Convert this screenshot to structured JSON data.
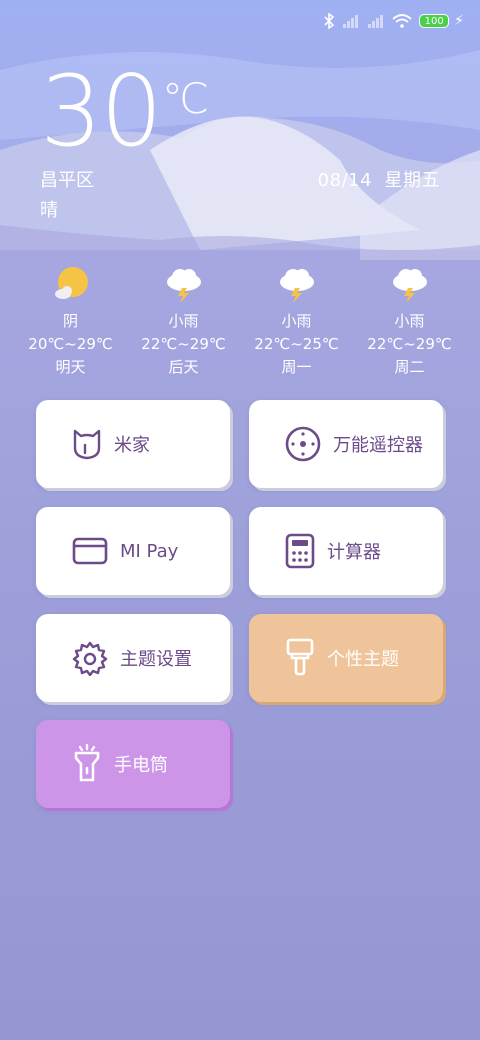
{
  "status_bar": {
    "icons": [
      "bluetooth-icon",
      "signal-icon",
      "signal-icon",
      "wifi-icon"
    ],
    "battery": "100",
    "charging_icon": "bolt-icon"
  },
  "current": {
    "temperature": "30",
    "unit": "℃",
    "location": "昌平区",
    "condition": "晴",
    "date": "08/14",
    "weekday": "星期五"
  },
  "forecast": [
    {
      "icon": "sun-cloud-icon",
      "condition": "阴",
      "range": "20℃~29℃",
      "day": "明天"
    },
    {
      "icon": "thunder-cloud-icon",
      "condition": "小雨",
      "range": "22℃~29℃",
      "day": "后天"
    },
    {
      "icon": "thunder-cloud-icon",
      "condition": "小雨",
      "range": "22℃~25℃",
      "day": "周一"
    },
    {
      "icon": "thunder-cloud-icon",
      "condition": "小雨",
      "range": "22℃~29℃",
      "day": "周二"
    }
  ],
  "tiles": [
    {
      "label": "米家",
      "icon": "mijia-icon",
      "style": "white"
    },
    {
      "label": "万能遥控器",
      "icon": "remote-icon",
      "style": "white"
    },
    {
      "label": "MI Pay",
      "icon": "card-icon",
      "style": "white"
    },
    {
      "label": "计算器",
      "icon": "calculator-icon",
      "style": "white"
    },
    {
      "label": "主题设置",
      "icon": "gear-icon",
      "style": "white"
    },
    {
      "label": "个性主题",
      "icon": "brush-icon",
      "style": "orange"
    },
    {
      "label": "手电筒",
      "icon": "flashlight-icon",
      "style": "purple"
    }
  ],
  "colors": {
    "accent_purple_text": "#6b4b8a",
    "tile_orange": "#efc49a",
    "tile_purple": "#cc95e8",
    "battery_green": "#4bd04b"
  }
}
